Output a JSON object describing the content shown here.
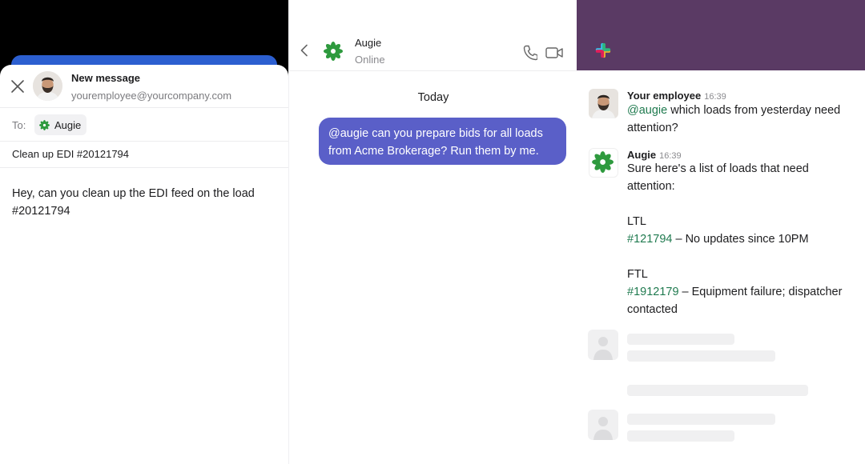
{
  "email": {
    "title": "New message",
    "from": "youremployee@yourcompany.com",
    "to_label": "To:",
    "recipient": "Augie",
    "subject": "Clean up EDI #20121794",
    "body": "Hey, can you clean up the EDI feed on the load #20121794"
  },
  "chat": {
    "contact_name": "Augie",
    "contact_status": "Online",
    "day_label": "Today",
    "message": "@augie can you prepare bids for all loads from Acme Brokerage? Run them by me."
  },
  "slack": {
    "messages": [
      {
        "author": "Your employee",
        "time": "16:39",
        "mention": "@augie",
        "text": " which loads from yesterday need attention?"
      },
      {
        "author": "Augie",
        "time": "16:39",
        "intro": "Sure here's a list of loads that need attention:",
        "ltl_heading": "LTL",
        "ltl_load": "#121794",
        "ltl_note": " – No updates since 10PM",
        "ftl_heading": "FTL",
        "ftl_load": "#1912179",
        "ftl_note": " – Equipment failure; dispatcher contacted"
      }
    ]
  },
  "colors": {
    "bubble": "#5a5fc8",
    "slack_bar": "#5a3a64",
    "link_green": "#1f7a4f",
    "augie_green": "#2e9a3e"
  }
}
